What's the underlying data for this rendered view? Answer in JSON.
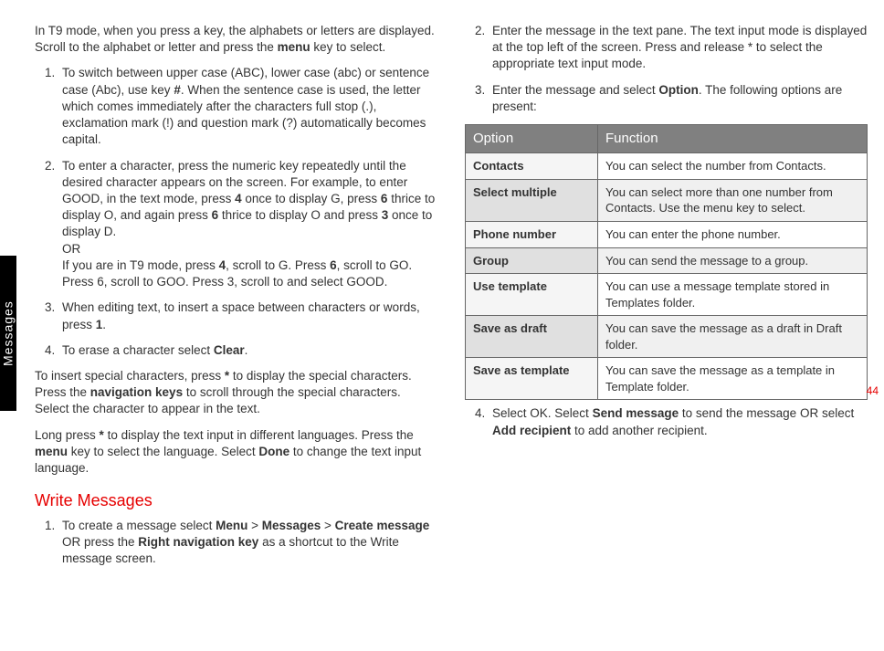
{
  "sideTab": "Messages",
  "pageNum": "44",
  "left": {
    "intro": "In T9 mode, when you press a key, the alphabets or letters are displayed. Scroll to the alphabet or letter and press the ",
    "introBold": "menu",
    "introEnd": " key to select.",
    "li1a": "To switch between upper case (ABC), lower case (abc) or sentence case (Abc), use key ",
    "li1key": "#",
    "li1b": ". When the sentence case is used, the letter which comes immediately after the characters full stop (.), exclamation mark (!) and question mark (?) automatically becomes capital.",
    "li2a": "To enter a character, press the numeric key repeatedly until the desired character appears on the screen. For example, to enter GOOD, in the text mode, press ",
    "li2k4": "4",
    "li2b": " once to display G, press ",
    "li2k6": "6",
    "li2c": " thrice to display O, and again press ",
    "li2k6b": "6",
    "li2d": " thrice to display O and press ",
    "li2k3": "3",
    "li2e": " once to display D.",
    "li2or": "OR",
    "li2f": "If you are in T9 mode, press ",
    "li2k4b": "4",
    "li2g": ", scroll to G. Press ",
    "li2k6c": "6",
    "li2h": ", scroll to GO. Press 6, scroll to GOO. Press 3, scroll to and select GOOD.",
    "li3a": "When editing text, to insert a space between characters or words, press ",
    "li3k1": "1",
    "li3b": ".",
    "li4a": "To erase a character select ",
    "li4k": "Clear",
    "li4b": ".",
    "p2a": "To insert special characters, press ",
    "p2star": "*",
    "p2b": " to display the special characters. Press the ",
    "p2nav": "navigation keys",
    "p2c": " to scroll through the special characters. Select the character to appear in the text.",
    "p3a": "Long press ",
    "p3star": "*",
    "p3b": " to display the text input in different languages. Press the ",
    "p3menu": "menu",
    "p3c": " key to select the language. Select ",
    "p3done": "Done",
    "p3d": " to change the text input language.",
    "heading": "Write Messages",
    "wli1a": "To create a message select ",
    "wli1menu": "Menu",
    "wli1gt1": " > ",
    "wli1msgs": "Messages",
    "wli1gt2": " > ",
    "wli1create": "Create message",
    "wli1or": " OR press the ",
    "wli1rnav": "Right navigation key",
    "wli1b": " as a shortcut to the Write message screen."
  },
  "right": {
    "li2": "Enter the message in the text pane. The text input mode is displayed at the top left of the screen. Press and release * to select the appropriate text input mode.",
    "li3a": "Enter the message and select ",
    "li3opt": "Option",
    "li3b": ". The following options are present:",
    "thOption": "Option",
    "thFunction": "Function",
    "rows": [
      {
        "k": "Contacts",
        "v": "You can select the number from Contacts."
      },
      {
        "k": "Select multiple",
        "v": "You can select more than one number from Contacts. Use the menu key to select."
      },
      {
        "k": "Phone number",
        "v": "You can enter the phone number."
      },
      {
        "k": "Group",
        "v": "You can send the message to a group."
      },
      {
        "k": "Use template",
        "v": "You can use a message template stored in Templates folder."
      },
      {
        "k": "Save as draft",
        "v": "You can save the message as a draft in Draft folder."
      },
      {
        "k": "Save as template",
        "v": "You can save the message as a template in Template folder."
      }
    ],
    "li4a": "Select OK. Select ",
    "li4send": "Send message",
    "li4b": " to send the message OR select ",
    "li4add": "Add recipient",
    "li4c": " to add another recipient."
  }
}
